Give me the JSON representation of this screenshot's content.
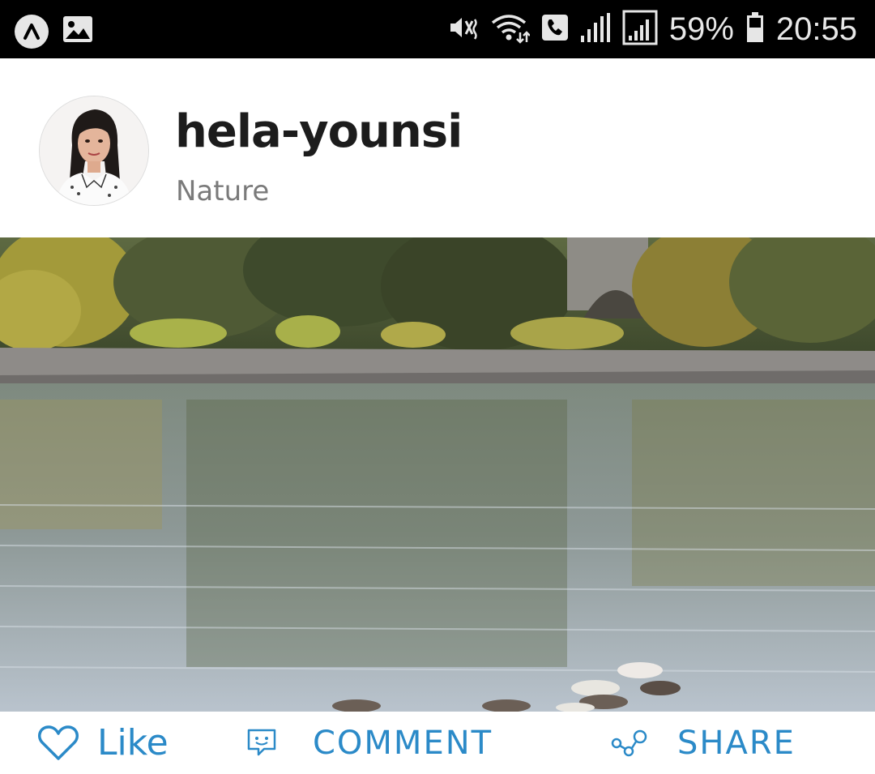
{
  "statusbar": {
    "battery_percent": "59%",
    "time": "20:55",
    "icons": [
      "app-icon",
      "gallery-icon",
      "mute-vibrate-icon",
      "wifi-icon",
      "call-icon",
      "signal-icon",
      "signal-icon-2",
      "battery-icon"
    ]
  },
  "post": {
    "username": "hela-younsi",
    "category": "Nature"
  },
  "actions": {
    "like_label": "Like",
    "comment_label": "COMMENT",
    "share_label": "SHARE"
  },
  "colors": {
    "accent": "#2b8ac8",
    "statusbar_bg": "#000000"
  }
}
